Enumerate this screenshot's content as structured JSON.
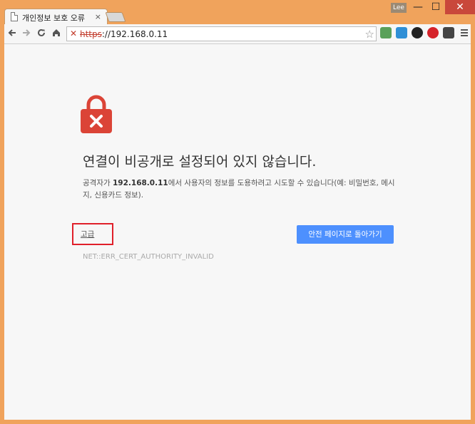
{
  "window": {
    "tab_title": "개인정보 보호 오류",
    "tab_close": "×",
    "user_label": "Lee",
    "min": "—",
    "max": "☐",
    "close": "✕"
  },
  "toolbar": {
    "url_scheme": "https",
    "url_rest": "://192.168.0.11"
  },
  "icons": {
    "back": "back-arrow-icon",
    "forward": "forward-arrow-icon",
    "reload": "reload-icon",
    "home": "home-icon",
    "broken_lock": "broken-lock-icon",
    "star": "star-icon",
    "menu": "menu-icon"
  },
  "page": {
    "heading": "연결이 비공개로 설정되어 있지 않습니다.",
    "desc_before": "공격자가 ",
    "desc_host": "192.168.0.11",
    "desc_after": "에서 사용자의 정보를 도용하려고 시도할 수 있습니다(예: 비밀번호, 메시지, 신용카드 정보).",
    "advanced_link": "고급",
    "back_to_safety": "안전 페이지로 돌아가기",
    "error_code": "NET::ERR_CERT_AUTHORITY_INVALID"
  },
  "colors": {
    "frame": "#f0a35c",
    "primary_button": "#4d90fe",
    "lock_red": "#db4437",
    "highlight_box": "#e0202a"
  }
}
